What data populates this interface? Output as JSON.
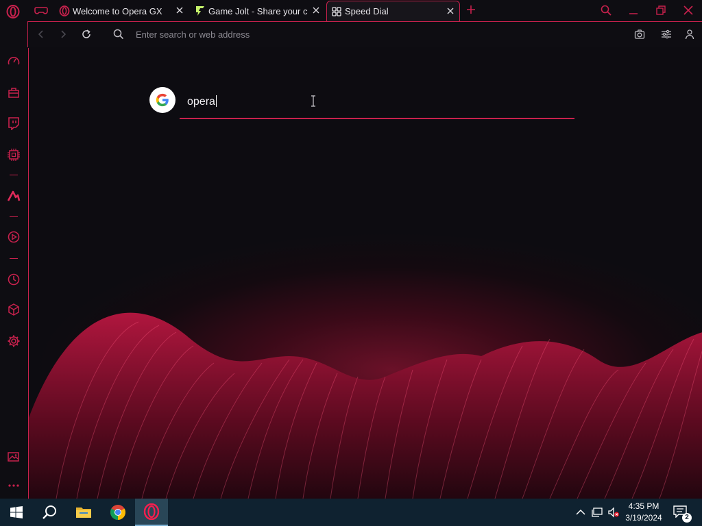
{
  "colors": {
    "accent": "#c8214d",
    "background": "#0d0c11",
    "taskbar": "#0f2230"
  },
  "tabs": [
    {
      "title": "Welcome to Opera GX",
      "icon": "opera-icon"
    },
    {
      "title": "Game Jolt - Share your crea",
      "icon": "gamejolt-icon"
    },
    {
      "title": "Speed Dial",
      "icon": "speed-dial-icon",
      "active": true
    }
  ],
  "address_bar": {
    "placeholder": "Enter search or web address"
  },
  "search": {
    "engine": "google-icon",
    "value": "opera"
  },
  "taskbar": {
    "time": "4:35 PM",
    "date": "3/19/2024",
    "notification_count": "2",
    "apps": [
      "start-icon",
      "search-icon",
      "file-explorer-icon",
      "chrome-icon",
      "opera-gx-icon"
    ]
  },
  "sidebar": {
    "items": [
      "speedometer-icon",
      "shopping-bag-icon",
      "twitch-icon",
      "cpu-icon",
      "aria-icon",
      "player-icon",
      "history-icon",
      "extensions-icon",
      "settings-icon",
      "wallpaper-icon",
      "more-icon"
    ]
  }
}
